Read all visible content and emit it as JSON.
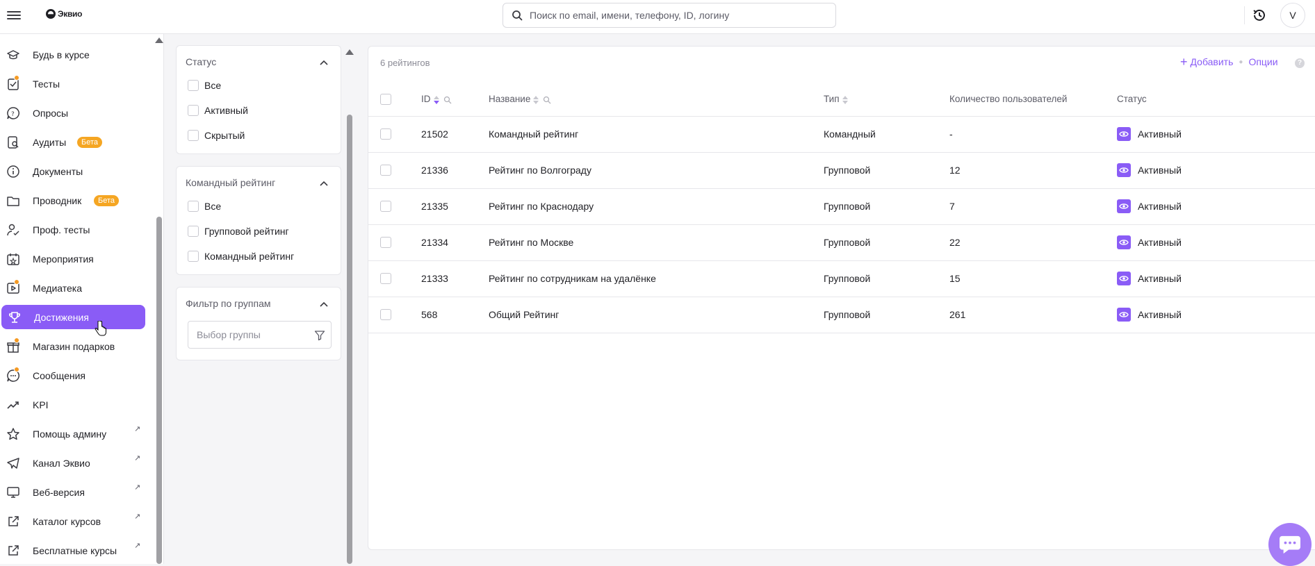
{
  "header": {
    "logo_text": "Эквио",
    "search_placeholder": "Поиск по email, имени, телефону, ID, логину",
    "avatar_initial": "V"
  },
  "sidebar": {
    "items": [
      {
        "label": "Будь в курсе",
        "icon": "graduation-cap-icon"
      },
      {
        "label": "Тесты",
        "icon": "test-checklist-icon",
        "dot": true
      },
      {
        "label": "Опросы",
        "icon": "survey-question-icon"
      },
      {
        "label": "Аудиты",
        "icon": "audit-search-icon",
        "badge": "Бета"
      },
      {
        "label": "Документы",
        "icon": "info-document-icon"
      },
      {
        "label": "Проводник",
        "icon": "folder-icon",
        "badge": "Бета"
      },
      {
        "label": "Проф. тесты",
        "icon": "user-check-icon"
      },
      {
        "label": "Мероприятия",
        "icon": "calendar-star-icon"
      },
      {
        "label": "Медиатека",
        "icon": "media-play-icon",
        "dot": true
      },
      {
        "label": "Достижения",
        "icon": "trophy-icon",
        "active": true
      },
      {
        "label": "Магазин подарков",
        "icon": "gift-icon",
        "dot": true
      },
      {
        "label": "Сообщения",
        "icon": "chat-bubble-icon",
        "dot": true
      },
      {
        "label": "KPI",
        "icon": "trend-up-icon"
      },
      {
        "label": "Помощь админу",
        "icon": "star-icon",
        "external": true
      },
      {
        "label": "Канал Эквио",
        "icon": "telegram-icon",
        "external": true
      },
      {
        "label": "Веб-версия",
        "icon": "monitor-icon",
        "external": true
      },
      {
        "label": "Каталог курсов",
        "icon": "external-link-icon",
        "external": true
      },
      {
        "label": "Бесплатные курсы",
        "icon": "external-link-icon",
        "external": true
      }
    ]
  },
  "filters": {
    "status": {
      "title": "Статус",
      "options": [
        "Все",
        "Активный",
        "Скрытый"
      ]
    },
    "team_rating": {
      "title": "Командный рейтинг",
      "options": [
        "Все",
        "Групповой рейтинг",
        "Командный рейтинг"
      ]
    },
    "group_filter": {
      "title": "Фильтр по группам",
      "placeholder": "Выбор группы"
    }
  },
  "main": {
    "count_label": "6 рейтингов",
    "add_label": "Добавить",
    "options_label": "Опции",
    "help_label": "?",
    "columns": [
      "ID",
      "Название",
      "Тип",
      "Количество пользователей",
      "Статус"
    ],
    "rows": [
      {
        "id": "21502",
        "name": "Командный рейтинг",
        "type": "Командный",
        "users": "-",
        "status": "Активный"
      },
      {
        "id": "21336",
        "name": "Рейтинг по Волгограду",
        "type": "Групповой",
        "users": "12",
        "status": "Активный"
      },
      {
        "id": "21335",
        "name": "Рейтинг по Краснодару",
        "type": "Групповой",
        "users": "7",
        "status": "Активный"
      },
      {
        "id": "21334",
        "name": "Рейтинг по Москве",
        "type": "Групповой",
        "users": "22",
        "status": "Активный"
      },
      {
        "id": "21333",
        "name": "Рейтинг по сотрудникам на удалёнке",
        "type": "Групповой",
        "users": "15",
        "status": "Активный"
      },
      {
        "id": "568",
        "name": "Общий Рейтинг",
        "type": "Групповой",
        "users": "261",
        "status": "Активный"
      }
    ]
  },
  "colors": {
    "accent": "#8a5cf6",
    "badge": "#f5a623",
    "dot": "#f59a23"
  }
}
